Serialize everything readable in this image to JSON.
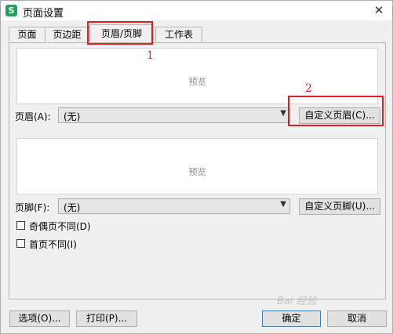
{
  "window": {
    "title": "页面设置",
    "app_icon": "S",
    "close_symbol": "✕"
  },
  "tabs": [
    {
      "label": "页面",
      "active": false
    },
    {
      "label": "页边距",
      "active": false
    },
    {
      "label": "页眉/页脚",
      "active": true
    },
    {
      "label": "工作表",
      "active": false
    }
  ],
  "header": {
    "preview_text": "预览",
    "label": "页眉(A):",
    "select_value": "(无)",
    "custom_button": "自定义页眉(C)..."
  },
  "footer": {
    "preview_text": "预览",
    "label": "页脚(F):",
    "select_value": "(无)",
    "custom_button": "自定义页脚(U)..."
  },
  "options": {
    "odd_even_label": "奇偶页不同(D)",
    "odd_even_checked": false,
    "first_page_label": "首页不同(I)",
    "first_page_checked": false
  },
  "buttons": {
    "options": "选项(O)...",
    "print": "打印(P)...",
    "ok": "确定",
    "cancel": "取消"
  },
  "annotations": {
    "marker1": "1",
    "marker2": "2",
    "color": "#e02020"
  },
  "watermark": "Bai 经验"
}
